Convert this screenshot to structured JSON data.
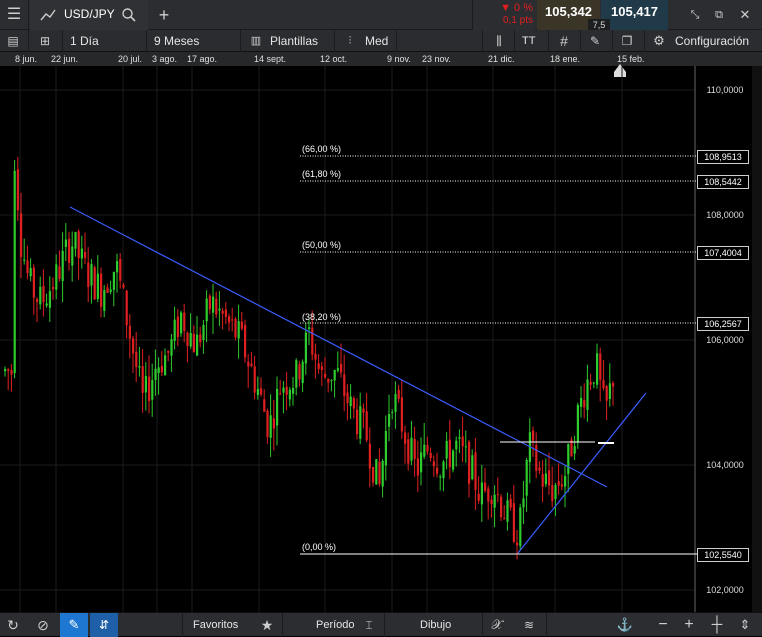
{
  "header": {
    "symbol": "USD/JPY",
    "change_pct": "▼ 0 %",
    "change_pts": "0,1 pts",
    "bid": "105,342",
    "ask": "105,417",
    "spread": "7,5"
  },
  "toolbar": {
    "timeframe": "1 Día",
    "range": "9 Meses",
    "templates": "Plantillas",
    "chart_style": "Med",
    "config": "Configuración",
    "text_tool": "TT"
  },
  "date_axis": [
    "8 jun.",
    "22 jun.",
    "20 jul.",
    "3 ago.",
    "17 ago.",
    "14 sept.",
    "12 oct.",
    "9 nov.",
    "23 nov.",
    "21 dic.",
    "18 ene.",
    "15 feb."
  ],
  "price_axis": [
    "110,0000",
    "108,0000",
    "106,0000",
    "104,0000",
    "102,0000"
  ],
  "fib_levels": [
    {
      "label": "(66,00 %)",
      "price": "108,9513"
    },
    {
      "label": "(61,80 %)",
      "price": "108,5442"
    },
    {
      "label": "(50,00 %)",
      "price": "107,4004"
    },
    {
      "label": "(38,20 %)",
      "price": "106,2567"
    },
    {
      "label": "(0,00 %)",
      "price": "102,5540"
    }
  ],
  "bottom": {
    "favorites": "Favoritos",
    "period": "Período",
    "drawing": "Dibujo"
  },
  "colors": {
    "up": "#2ecc2e",
    "down": "#e02020",
    "trend": "#3a5cff"
  }
}
